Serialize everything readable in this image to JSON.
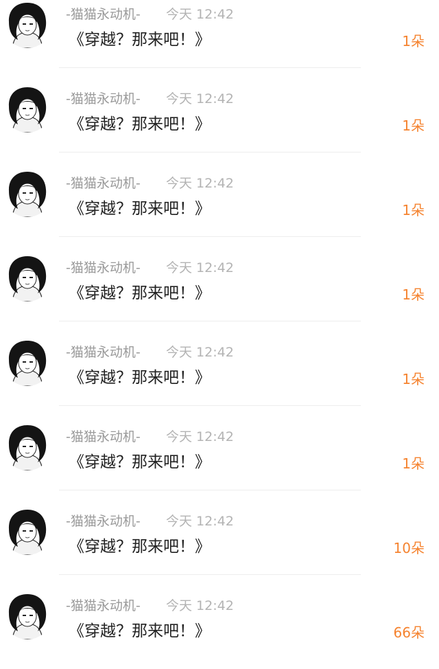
{
  "list": {
    "items": [
      {
        "username": "-猫猫永动机-",
        "time": "今天 12:42",
        "title": "《穿越？那来吧！》",
        "count": "1朵"
      },
      {
        "username": "-猫猫永动机-",
        "time": "今天 12:42",
        "title": "《穿越？那来吧！》",
        "count": "1朵"
      },
      {
        "username": "-猫猫永动机-",
        "time": "今天 12:42",
        "title": "《穿越？那来吧！》",
        "count": "1朵"
      },
      {
        "username": "-猫猫永动机-",
        "time": "今天 12:42",
        "title": "《穿越？那来吧！》",
        "count": "1朵"
      },
      {
        "username": "-猫猫永动机-",
        "time": "今天 12:42",
        "title": "《穿越？那来吧！》",
        "count": "1朵"
      },
      {
        "username": "-猫猫永动机-",
        "time": "今天 12:42",
        "title": "《穿越？那来吧！》",
        "count": "1朵"
      },
      {
        "username": "-猫猫永动机-",
        "time": "今天 12:42",
        "title": "《穿越？那来吧！》",
        "count": "10朵"
      },
      {
        "username": "-猫猫永动机-",
        "time": "今天 12:42",
        "title": "《穿越？那来吧！》",
        "count": "66朵"
      }
    ]
  },
  "avatar": {
    "icon": "avatar-icon"
  },
  "colors": {
    "count_accent": "#f5832f",
    "username": "#9a9a9a",
    "time": "#b3b3b3",
    "title": "#222222"
  }
}
